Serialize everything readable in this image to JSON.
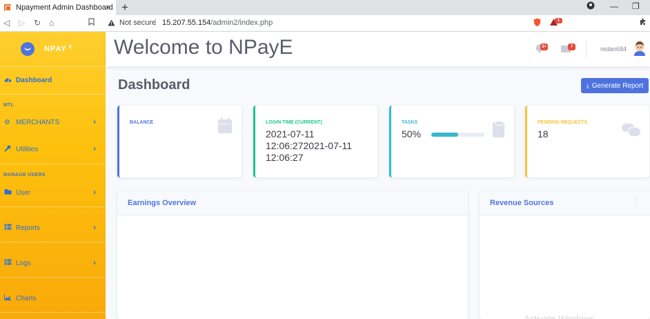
{
  "browser": {
    "tab_title": "Npayment Admin Dashboard",
    "tab_close": "×",
    "new_tab": "+",
    "security_label": "Not secure",
    "url_host": "15.207.55.154",
    "url_path": "/admin2/index.php",
    "shield_badge": "1"
  },
  "sidebar": {
    "brand": "NPAY",
    "brand_sup": "E",
    "items": [
      {
        "label": "Dashboard",
        "icon": "tachometer-icon"
      },
      {
        "label": "MERCHANTS",
        "icon": "gear-icon"
      },
      {
        "label": "Utilities",
        "icon": "wrench-icon"
      },
      {
        "label": "User",
        "icon": "folder-icon"
      },
      {
        "label": "Reports",
        "icon": "table-icon"
      },
      {
        "label": "Logs",
        "icon": "table-icon"
      },
      {
        "label": "Charts",
        "icon": "area-chart-icon"
      }
    ],
    "headings": [
      "MTL",
      "MANAGE USERS"
    ],
    "accent": "#fdc10d"
  },
  "topbar": {
    "welcome": "Welcome to NPayE",
    "alerts_count": "3+",
    "messages_count": "7",
    "username": "redan684"
  },
  "main": {
    "title": "Dashboard",
    "generate_report": "Generate Report",
    "cards": [
      {
        "label": "BALANCE",
        "value": "",
        "color": "#4e73df"
      },
      {
        "label": "LOGIN TIME (CURRENT)",
        "value": "2021-07-11 12:06:272021-07-11 12:06:27",
        "color": "#1cc88a"
      },
      {
        "label": "TASKS",
        "value": "50%",
        "progress": 0.5,
        "color": "#36b9cc"
      },
      {
        "label": "PENDING REQUESTS",
        "value": "18",
        "color": "#f6c23e"
      }
    ],
    "panels": [
      {
        "title": "Earnings Overview"
      },
      {
        "title": "Revenue Sources"
      }
    ],
    "watermark": "Activate Windows"
  }
}
